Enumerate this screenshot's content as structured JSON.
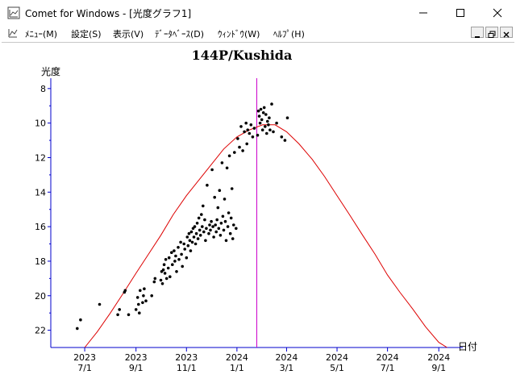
{
  "window": {
    "title": "Comet for Windows - [光度グラフ1]",
    "icons": {
      "app": "comet-graph-icon",
      "minimize": "minimize-icon",
      "maximize": "maximize-icon",
      "close": "close-icon"
    }
  },
  "menu": {
    "items": [
      {
        "label": "ﾒﾆｭｰ(M)"
      },
      {
        "label": "設定(S)"
      },
      {
        "label": "表示(V)"
      },
      {
        "label": "ﾃﾞｰﾀﾍﾞｰｽ(D)"
      },
      {
        "label": "ｳｨﾝﾄﾞｳ(W)"
      },
      {
        "label": "ﾍﾙﾌﾟ(H)"
      }
    ],
    "mdi_icons": [
      "mdi-minimize-icon",
      "mdi-restore-icon",
      "mdi-close-icon"
    ]
  },
  "chart_data": {
    "type": "scatter",
    "title": "144P/Kushida",
    "ylabel": "光度",
    "xlabel": "日付",
    "y_reversed": true,
    "ylim": [
      23,
      7.4
    ],
    "xlim": [
      "2023-05-21",
      "2024-09-30"
    ],
    "y_ticks": [
      8,
      10,
      12,
      14,
      16,
      18,
      20,
      22
    ],
    "x_ticks": [
      {
        "date": "2023-07-01",
        "year": "2023",
        "md": "7/1"
      },
      {
        "date": "2023-09-01",
        "year": "2023",
        "md": "9/1"
      },
      {
        "date": "2023-11-01",
        "year": "2023",
        "md": "11/1"
      },
      {
        "date": "2024-01-01",
        "year": "2024",
        "md": "1/1"
      },
      {
        "date": "2024-03-01",
        "year": "2024",
        "md": "3/1"
      },
      {
        "date": "2024-05-01",
        "year": "2024",
        "md": "5/1"
      },
      {
        "date": "2024-07-01",
        "year": "2024",
        "md": "7/1"
      },
      {
        "date": "2024-09-01",
        "year": "2024",
        "md": "9/1"
      }
    ],
    "today_marker": "2024-01-25",
    "colors": {
      "axis": "#0000cc",
      "curve": "#dd0000",
      "marker": "#cc00cc",
      "points": "#000000"
    },
    "prediction_curve": [
      [
        "2023-07-01",
        23.0
      ],
      [
        "2023-07-16",
        22.1
      ],
      [
        "2023-08-01",
        21.0
      ],
      [
        "2023-08-16",
        19.9
      ],
      [
        "2023-09-01",
        18.7
      ],
      [
        "2023-09-16",
        17.6
      ],
      [
        "2023-10-01",
        16.5
      ],
      [
        "2023-10-16",
        15.3
      ],
      [
        "2023-11-01",
        14.2
      ],
      [
        "2023-11-16",
        13.3
      ],
      [
        "2023-12-01",
        12.4
      ],
      [
        "2023-12-16",
        11.5
      ],
      [
        "2024-01-01",
        10.8
      ],
      [
        "2024-01-16",
        10.4
      ],
      [
        "2024-02-01",
        10.1
      ],
      [
        "2024-02-16",
        10.1
      ],
      [
        "2024-03-01",
        10.5
      ],
      [
        "2024-03-16",
        11.2
      ],
      [
        "2024-04-01",
        12.1
      ],
      [
        "2024-04-16",
        13.1
      ],
      [
        "2024-05-01",
        14.2
      ],
      [
        "2024-05-16",
        15.3
      ],
      [
        "2024-06-01",
        16.5
      ],
      [
        "2024-06-16",
        17.6
      ],
      [
        "2024-07-01",
        18.8
      ],
      [
        "2024-07-16",
        19.8
      ],
      [
        "2024-08-01",
        20.8
      ],
      [
        "2024-08-16",
        21.8
      ],
      [
        "2024-09-01",
        22.7
      ],
      [
        "2024-09-11",
        23.0
      ]
    ],
    "observations": [
      [
        "2023-06-22",
        21.9
      ],
      [
        "2023-06-26",
        21.4
      ],
      [
        "2023-07-19",
        20.5
      ],
      [
        "2023-08-10",
        21.1
      ],
      [
        "2023-08-12",
        20.8
      ],
      [
        "2023-08-18",
        19.8
      ],
      [
        "2023-08-19",
        19.7
      ],
      [
        "2023-08-23",
        21.1
      ],
      [
        "2023-09-01",
        20.8
      ],
      [
        "2023-09-03",
        20.1
      ],
      [
        "2023-09-04",
        20.5
      ],
      [
        "2023-09-05",
        21.0
      ],
      [
        "2023-09-06",
        19.7
      ],
      [
        "2023-09-09",
        20.4
      ],
      [
        "2023-09-10",
        20.0
      ],
      [
        "2023-09-11",
        19.6
      ],
      [
        "2023-09-13",
        20.3
      ],
      [
        "2023-09-20",
        20.0
      ],
      [
        "2023-09-23",
        19.2
      ],
      [
        "2023-09-24",
        19.0
      ],
      [
        "2023-10-01",
        19.1
      ],
      [
        "2023-10-02",
        18.6
      ],
      [
        "2023-10-03",
        19.3
      ],
      [
        "2023-10-04",
        18.5
      ],
      [
        "2023-10-05",
        18.2
      ],
      [
        "2023-10-06",
        18.7
      ],
      [
        "2023-10-07",
        17.9
      ],
      [
        "2023-10-08",
        19.0
      ],
      [
        "2023-10-10",
        18.4
      ],
      [
        "2023-10-11",
        17.8
      ],
      [
        "2023-10-12",
        18.9
      ],
      [
        "2023-10-14",
        17.5
      ],
      [
        "2023-10-15",
        18.2
      ],
      [
        "2023-10-17",
        17.4
      ],
      [
        "2023-10-18",
        18.0
      ],
      [
        "2023-10-19",
        17.7
      ],
      [
        "2023-10-20",
        18.6
      ],
      [
        "2023-10-22",
        17.2
      ],
      [
        "2023-10-23",
        17.9
      ],
      [
        "2023-10-25",
        16.9
      ],
      [
        "2023-10-26",
        17.6
      ],
      [
        "2023-10-27",
        18.3
      ],
      [
        "2023-10-29",
        17.0
      ],
      [
        "2023-10-30",
        17.3
      ],
      [
        "2023-11-01",
        17.8
      ],
      [
        "2023-11-02",
        16.6
      ],
      [
        "2023-11-03",
        17.1
      ],
      [
        "2023-11-04",
        16.4
      ],
      [
        "2023-11-05",
        16.8
      ],
      [
        "2023-11-06",
        17.4
      ],
      [
        "2023-11-07",
        16.3
      ],
      [
        "2023-11-08",
        16.9
      ],
      [
        "2023-11-09",
        16.1
      ],
      [
        "2023-11-10",
        16.6
      ],
      [
        "2023-11-11",
        16.0
      ],
      [
        "2023-11-12",
        17.0
      ],
      [
        "2023-11-13",
        16.4
      ],
      [
        "2023-11-14",
        15.8
      ],
      [
        "2023-11-15",
        16.7
      ],
      [
        "2023-11-16",
        15.5
      ],
      [
        "2023-11-17",
        16.2
      ],
      [
        "2023-11-18",
        16.5
      ],
      [
        "2023-11-19",
        15.3
      ],
      [
        "2023-11-20",
        16.0
      ],
      [
        "2023-11-21",
        14.8
      ],
      [
        "2023-11-22",
        16.3
      ],
      [
        "2023-11-23",
        15.6
      ],
      [
        "2023-11-24",
        16.8
      ],
      [
        "2023-11-25",
        16.1
      ],
      [
        "2023-11-26",
        13.6
      ],
      [
        "2023-11-28",
        16.4
      ],
      [
        "2023-11-29",
        15.9
      ],
      [
        "2023-11-30",
        16.2
      ],
      [
        "2023-12-01",
        15.7
      ],
      [
        "2023-12-02",
        12.7
      ],
      [
        "2023-12-03",
        16.0
      ],
      [
        "2023-12-04",
        16.6
      ],
      [
        "2023-12-05",
        14.3
      ],
      [
        "2023-12-06",
        15.9
      ],
      [
        "2023-12-07",
        16.3
      ],
      [
        "2023-12-08",
        15.6
      ],
      [
        "2023-12-09",
        14.9
      ],
      [
        "2023-12-10",
        16.1
      ],
      [
        "2023-12-11",
        13.9
      ],
      [
        "2023-12-12",
        16.5
      ],
      [
        "2023-12-13",
        15.8
      ],
      [
        "2023-12-14",
        12.3
      ],
      [
        "2023-12-15",
        15.4
      ],
      [
        "2023-12-16",
        16.2
      ],
      [
        "2023-12-17",
        14.4
      ],
      [
        "2023-12-18",
        15.7
      ],
      [
        "2023-12-19",
        16.8
      ],
      [
        "2023-12-20",
        12.6
      ],
      [
        "2023-12-21",
        16.0
      ],
      [
        "2023-12-22",
        15.2
      ],
      [
        "2023-12-23",
        11.9
      ],
      [
        "2023-12-24",
        16.4
      ],
      [
        "2023-12-25",
        15.5
      ],
      [
        "2023-12-26",
        13.8
      ],
      [
        "2023-12-27",
        16.7
      ],
      [
        "2023-12-28",
        15.9
      ],
      [
        "2023-12-29",
        11.7
      ],
      [
        "2023-12-31",
        16.1
      ],
      [
        "2024-01-02",
        10.9
      ],
      [
        "2024-01-04",
        11.4
      ],
      [
        "2024-01-06",
        10.2
      ],
      [
        "2024-01-08",
        11.6
      ],
      [
        "2024-01-10",
        10.5
      ],
      [
        "2024-01-12",
        10.0
      ],
      [
        "2024-01-13",
        11.2
      ],
      [
        "2024-01-14",
        10.4
      ],
      [
        "2024-01-16",
        10.6
      ],
      [
        "2024-01-18",
        10.1
      ],
      [
        "2024-01-20",
        10.8
      ],
      [
        "2024-01-22",
        10.3
      ],
      [
        "2024-01-26",
        10.7
      ],
      [
        "2024-01-27",
        9.3
      ],
      [
        "2024-01-28",
        9.6
      ],
      [
        "2024-01-29",
        10.0
      ],
      [
        "2024-01-30",
        9.2
      ],
      [
        "2024-01-31",
        9.8
      ],
      [
        "2024-02-01",
        10.4
      ],
      [
        "2024-02-02",
        9.4
      ],
      [
        "2024-02-03",
        9.1
      ],
      [
        "2024-02-04",
        10.2
      ],
      [
        "2024-02-05",
        9.5
      ],
      [
        "2024-02-06",
        10.6
      ],
      [
        "2024-02-07",
        9.9
      ],
      [
        "2024-02-08",
        10.1
      ],
      [
        "2024-02-09",
        9.7
      ],
      [
        "2024-02-10",
        10.4
      ],
      [
        "2024-02-12",
        8.9
      ],
      [
        "2024-02-14",
        10.5
      ],
      [
        "2024-02-18",
        10.0
      ],
      [
        "2024-02-24",
        10.8
      ],
      [
        "2024-02-28",
        11.0
      ],
      [
        "2024-03-02",
        9.7
      ]
    ]
  }
}
